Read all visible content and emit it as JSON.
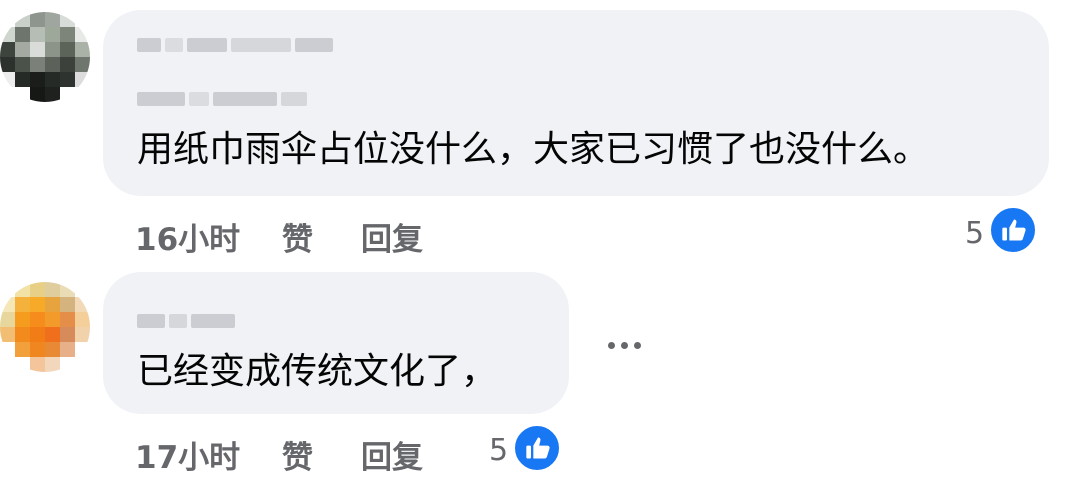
{
  "comments": [
    {
      "text": "用纸巾雨伞占位没什么，大家已习惯了也没什么。",
      "time": "16小时",
      "like_label": "赞",
      "reply_label": "回复",
      "reaction_count": "5",
      "reaction_icon": "thumbs-up-icon"
    },
    {
      "text": "已经变成传统文化了，",
      "time": "17小时",
      "like_label": "赞",
      "reply_label": "回复",
      "reaction_count": "5",
      "reaction_icon": "thumbs-up-icon"
    }
  ],
  "more_icon": "more-options-icon",
  "colors": {
    "bubble": "#f0f2f5",
    "meta_text": "#65676b",
    "like_blue": "#1877f2"
  }
}
